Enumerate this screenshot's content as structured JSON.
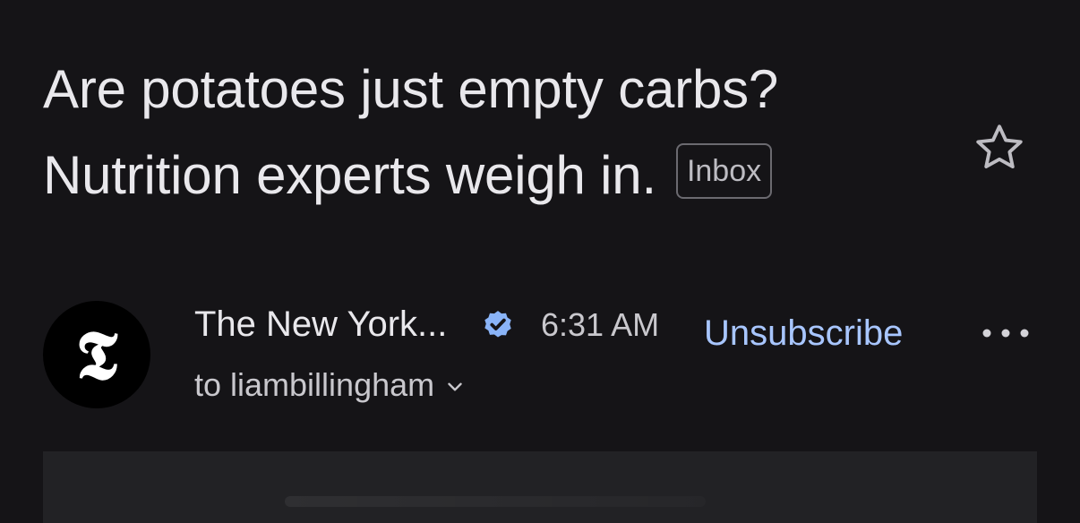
{
  "subject": {
    "line1": "Are potatoes just empty carbs?",
    "line2": "Nutrition experts weigh in.",
    "label": "Inbox"
  },
  "star": {
    "icon": "star-outline-icon",
    "starred": false
  },
  "sender": {
    "avatar_icon": "nyt-logo-icon",
    "avatar_glyph": "𝕿",
    "name": "The New York...",
    "verified_icon": "verified-badge-icon",
    "time": "6:31 AM",
    "unsubscribe_label": "Unsubscribe",
    "more_icon": "more-horizontal-icon",
    "recipient": "to liambillingham",
    "recipient_chevron_icon": "chevron-down-icon"
  },
  "colors": {
    "background": "#151417",
    "text": "#e9e8ec",
    "muted": "#c9c8cd",
    "link": "#a8c6ff",
    "verified": "#8ab4f8"
  }
}
